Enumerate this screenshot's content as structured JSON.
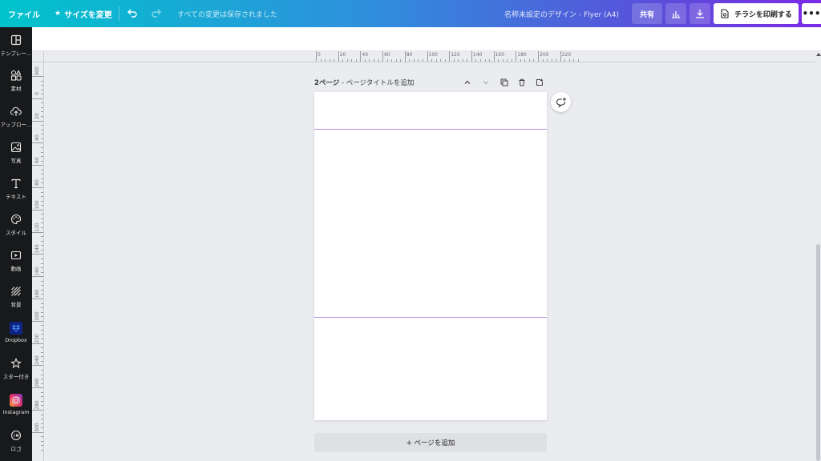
{
  "topbar": {
    "file_label": "ファイル",
    "resize_label": "サイズを変更",
    "saved_status": "すべての変更は保存されました",
    "document_title": "名称未設定のデザイン - Flyer (A4)",
    "share_label": "共有",
    "print_label": "チラシを印刷する",
    "more_label": "•••"
  },
  "sidebar": {
    "items": [
      {
        "label": "テンプレー…",
        "icon": "template-icon"
      },
      {
        "label": "素材",
        "icon": "elements-icon"
      },
      {
        "label": "アップロー…",
        "icon": "upload-icon"
      },
      {
        "label": "写真",
        "icon": "photo-icon"
      },
      {
        "label": "テキスト",
        "icon": "text-icon"
      },
      {
        "label": "スタイル",
        "icon": "palette-icon"
      },
      {
        "label": "動画",
        "icon": "video-icon"
      },
      {
        "label": "背景",
        "icon": "background-icon"
      },
      {
        "label": "Dropbox",
        "icon": "dropbox-icon"
      },
      {
        "label": "スター付き",
        "icon": "star-icon"
      },
      {
        "label": "Instagram",
        "icon": "instagram-icon"
      },
      {
        "label": "ロゴ",
        "icon": "logo-icon"
      }
    ]
  },
  "ruler": {
    "top_ticks": [
      "0",
      "20",
      "40",
      "60",
      "80",
      "100",
      "120",
      "140",
      "160",
      "180",
      "200",
      "220"
    ],
    "left_ticks": [
      "300",
      "0",
      "20",
      "40",
      "60",
      "80",
      "100",
      "120",
      "140",
      "160",
      "180",
      "200",
      "220",
      "240",
      "260",
      "280",
      "300"
    ]
  },
  "page_header": {
    "page_number": "2ページ",
    "title_placeholder": " - ページタイトルを追加"
  },
  "add_page_label": "+ ページを追加",
  "colors": {
    "guide": "#b68fe0",
    "sidebar_bg": "#18191b",
    "canvas_bg": "#ebecf0"
  }
}
